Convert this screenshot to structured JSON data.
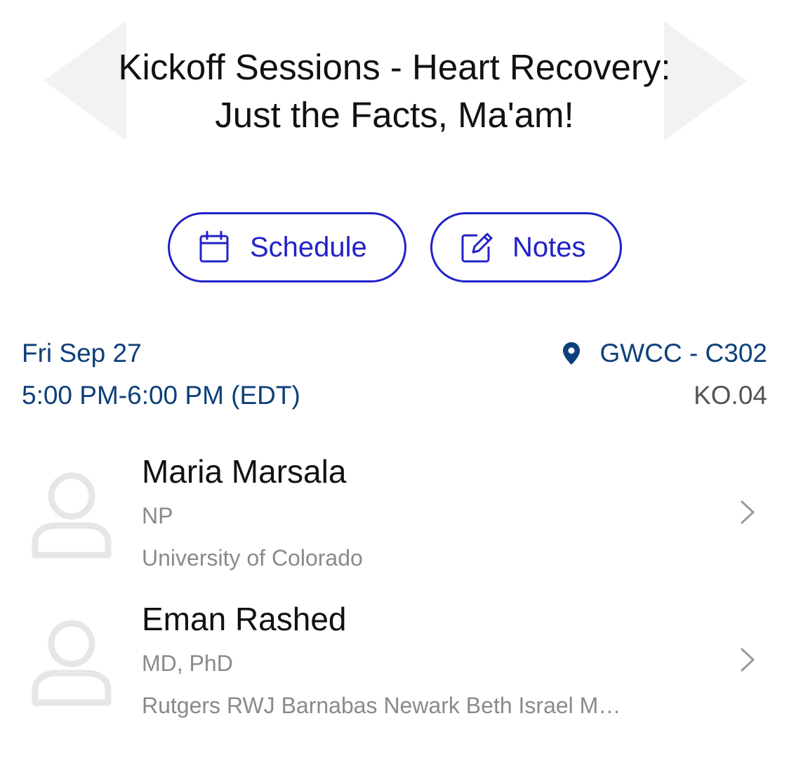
{
  "session": {
    "title_line1": "Kickoff Sessions - Heart Recovery:",
    "title_line2": "Just the Facts, Ma'am!",
    "date": "Fri Sep 27",
    "time": "5:00 PM-6:00 PM (EDT)",
    "location": "GWCC - C302",
    "code": "KO.04"
  },
  "actions": {
    "schedule_label": "Schedule",
    "notes_label": "Notes"
  },
  "speakers": [
    {
      "name": "Maria Marsala",
      "credential": "NP",
      "affiliation": "University of Colorado"
    },
    {
      "name": "Eman Rashed",
      "credential": "MD, PhD",
      "affiliation": "Rutgers RWJ Barnabas Newark Beth Israel M…"
    }
  ],
  "icons": {
    "prev": "chevron-left-icon",
    "next": "chevron-right-icon",
    "schedule": "calendar-icon",
    "notes": "edit-note-icon",
    "location": "map-pin-icon",
    "avatar": "person-placeholder-icon",
    "row_arrow": "chevron-right-icon"
  },
  "colors": {
    "accent": "#2222c8",
    "meta_text": "#0d3f7a",
    "secondary_text": "#8a8a8a",
    "nav_arrow": "#f2f2f2"
  }
}
